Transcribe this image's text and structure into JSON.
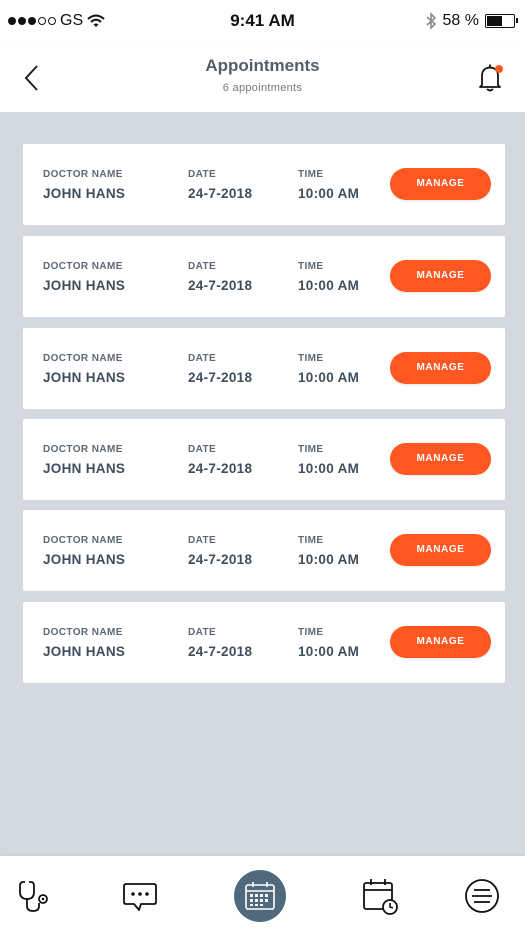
{
  "status_bar": {
    "carrier": "GS",
    "time": "9:41 AM",
    "battery_percent": "58 %",
    "battery_level": 0.58
  },
  "header": {
    "title": "Appointments",
    "subtitle": "6 appointments",
    "back_icon": "chevron-left-icon",
    "notification_icon": "bell-icon",
    "notification_dot_color": "#ff5722"
  },
  "labels": {
    "doctor": "DOCTOR NAME",
    "date": "DATE",
    "time": "TIME",
    "manage": "MANAGE"
  },
  "appointments": [
    {
      "doctor": "JOHN HANS",
      "date": "24-7-2018",
      "time": "10:00 AM"
    },
    {
      "doctor": "JOHN HANS",
      "date": "24-7-2018",
      "time": "10:00 AM"
    },
    {
      "doctor": "JOHN HANS",
      "date": "24-7-2018",
      "time": "10:00 AM"
    },
    {
      "doctor": "JOHN HANS",
      "date": "24-7-2018",
      "time": "10:00 AM"
    },
    {
      "doctor": "JOHN HANS",
      "date": "24-7-2018",
      "time": "10:00 AM"
    },
    {
      "doctor": "JOHN HANS",
      "date": "24-7-2018",
      "time": "10:00 AM"
    }
  ],
  "tabs": [
    {
      "icon": "stethoscope-icon",
      "active": false
    },
    {
      "icon": "chat-icon",
      "active": false
    },
    {
      "icon": "calendar-icon",
      "active": true
    },
    {
      "icon": "calendar-clock-icon",
      "active": false
    },
    {
      "icon": "menu-icon",
      "active": false
    }
  ],
  "colors": {
    "accent": "#ff5722",
    "background": "#d3d9df",
    "active_tab": "#50697c",
    "text": "#3f4e5e"
  }
}
